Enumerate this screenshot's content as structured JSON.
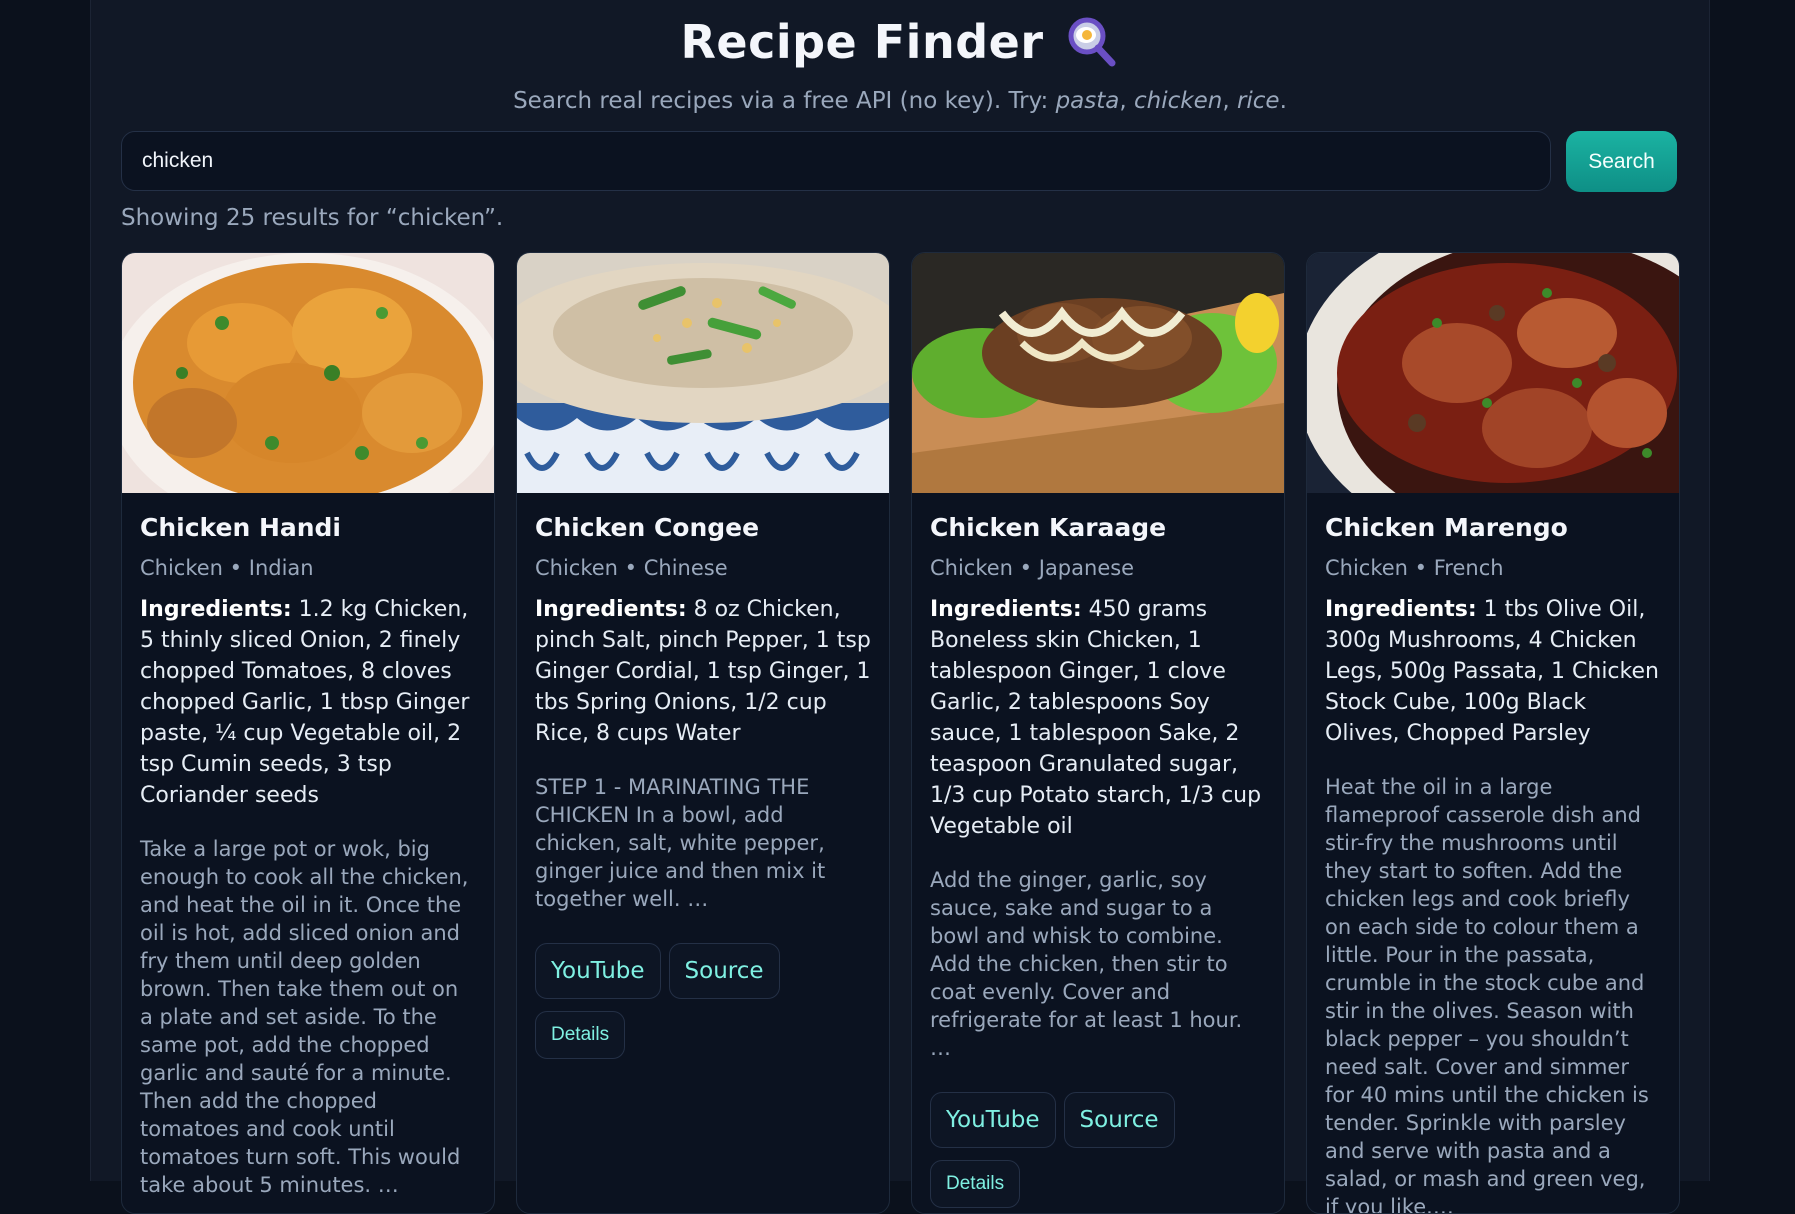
{
  "header": {
    "title": "Recipe Finder",
    "title_icon": "magnifier-egg-icon",
    "subtitle_prefix": "Search real recipes via a free API (no key). Try: ",
    "subtitle_examples": [
      "pasta",
      "chicken",
      "rice"
    ]
  },
  "search": {
    "value": "chicken",
    "button_label": "Search"
  },
  "status": "Showing 25 results for “chicken”.",
  "cards": [
    {
      "title": "Chicken Handi",
      "category": "Chicken",
      "area": "Indian",
      "ingredients_label": "Ingredients:",
      "ingredients": "1.2 kg Chicken, 5 thinly sliced Onion, 2 finely chopped Tomatoes, 8 cloves chopped Garlic, 1 tbsp Ginger paste, ¼ cup Vegetable oil, 2 tsp Cumin seeds, 3 tsp Coriander seeds",
      "instructions": "Take a large pot or wok, big enough to cook all the chicken, and heat the oil in it. Once the oil is hot, add sliced onion and fry them until deep golden brown. Then take them out on a plate and set aside. To the same pot, add the chopped garlic and sauté for a minute. Then add the chopped tomatoes and cook until tomatoes turn soft. This would take about 5 minutes. …",
      "links": [],
      "details_label": ""
    },
    {
      "title": "Chicken Congee",
      "category": "Chicken",
      "area": "Chinese",
      "ingredients_label": "Ingredients:",
      "ingredients": "8 oz Chicken, pinch Salt, pinch Pepper, 1 tsp Ginger Cordial, 1 tsp Ginger, 1 tbs Spring Onions, 1/2 cup Rice, 8 cups Water",
      "instructions": "STEP 1 - MARINATING THE CHICKEN In a bowl, add chicken, salt, white pepper, ginger juice and then mix it together well. …",
      "links": [
        "YouTube",
        "Source"
      ],
      "details_label": "Details"
    },
    {
      "title": "Chicken Karaage",
      "category": "Chicken",
      "area": "Japanese",
      "ingredients_label": "Ingredients:",
      "ingredients": "450 grams Boneless skin Chicken, 1 tablespoon Ginger, 1 clove Garlic, 2 tablespoons Soy sauce, 1 tablespoon Sake, 2 teaspoon Granulated sugar, 1/3 cup Potato starch, 1/3 cup Vegetable oil",
      "instructions": "Add the ginger, garlic, soy sauce, sake and sugar to a bowl and whisk to combine. Add the chicken, then stir to coat evenly. Cover and refrigerate for at least 1 hour. …",
      "links": [
        "YouTube",
        "Source"
      ],
      "details_label": "Details"
    },
    {
      "title": "Chicken Marengo",
      "category": "Chicken",
      "area": "French",
      "ingredients_label": "Ingredients:",
      "ingredients": "1 tbs Olive Oil, 300g Mushrooms, 4 Chicken Legs, 500g Passata, 1 Chicken Stock Cube, 100g Black Olives, Chopped Parsley",
      "instructions": "Heat the oil in a large flameproof casserole dish and stir-fry the mushrooms until they start to soften. Add the chicken legs and cook briefly on each side to colour them a little. Pour in the passata, crumble in the stock cube and stir in the olives. Season with black pepper – you shouldn’t need salt. Cover and simmer for 40 mins until the chicken is tender. Sprinkle with parsley and serve with pasta and a salad, or mash and green veg, if you like.…",
      "links": [],
      "details_label": ""
    }
  ]
}
